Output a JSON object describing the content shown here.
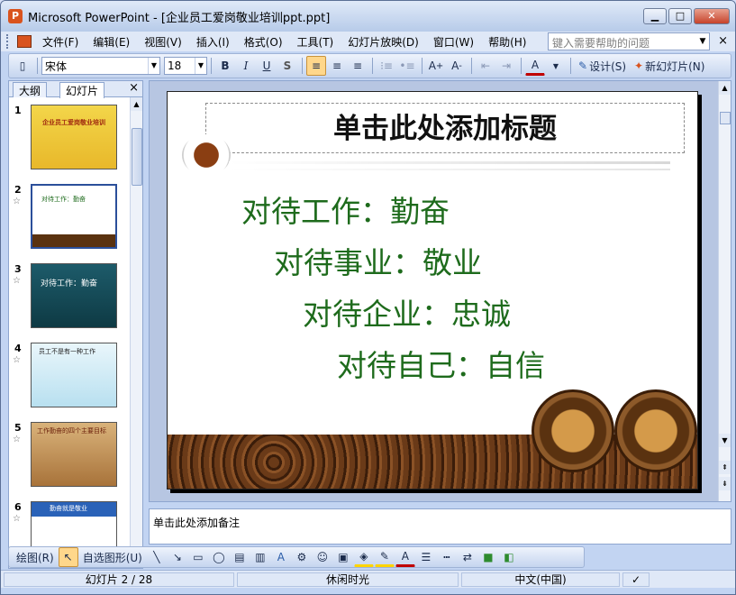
{
  "window": {
    "app_title": "Microsoft PowerPoint - [企业员工爱岗敬业培训ppt.ppt]"
  },
  "menubar": {
    "items": [
      {
        "label": "文件(F)"
      },
      {
        "label": "编辑(E)"
      },
      {
        "label": "视图(V)"
      },
      {
        "label": "插入(I)"
      },
      {
        "label": "格式(O)"
      },
      {
        "label": "工具(T)"
      },
      {
        "label": "幻灯片放映(D)"
      },
      {
        "label": "窗口(W)"
      },
      {
        "label": "帮助(H)"
      }
    ],
    "help_placeholder": "键入需要帮助的问题",
    "close": "×"
  },
  "toolbar": {
    "font_name": "宋体",
    "font_size": "18",
    "bold": "B",
    "italic": "I",
    "underline": "U",
    "shadow": "S",
    "font_color_label": "A",
    "design_label": "设计(S)",
    "new_slide_label": "新幻灯片(N)"
  },
  "left_panel": {
    "tab_outline": "大纲",
    "tab_slides": "幻灯片",
    "close": "×",
    "thumbnails": [
      {
        "num": "1",
        "title": "企业员工爱岗敬业培训"
      },
      {
        "num": "2",
        "title": "对待工作：勤奋"
      },
      {
        "num": "3",
        "title": "对待工作：勤奋"
      },
      {
        "num": "4",
        "title": "员工不是有一种工作"
      },
      {
        "num": "5",
        "title": "工作勤奋的四个主要目标"
      },
      {
        "num": "6",
        "title": "勤奋就是敬业"
      }
    ]
  },
  "slide": {
    "title": "单击此处添加标题",
    "lines": [
      "对待工作：勤奋",
      "对待事业：敬业",
      "对待企业：忠诚",
      "对待自己：自信"
    ],
    "text_color": "#1e6b1c"
  },
  "notes": {
    "placeholder": "单击此处添加备注"
  },
  "drawbar": {
    "draw_label": "绘图(R)",
    "autoshapes_label": "自选图形(U)"
  },
  "status": {
    "slide_pos": "幻灯片 2 / 28",
    "design": "休闲时光",
    "language": "中文(中国)"
  },
  "colors": {
    "accent": "#d9531e",
    "chrome": "#c2d4f2"
  }
}
